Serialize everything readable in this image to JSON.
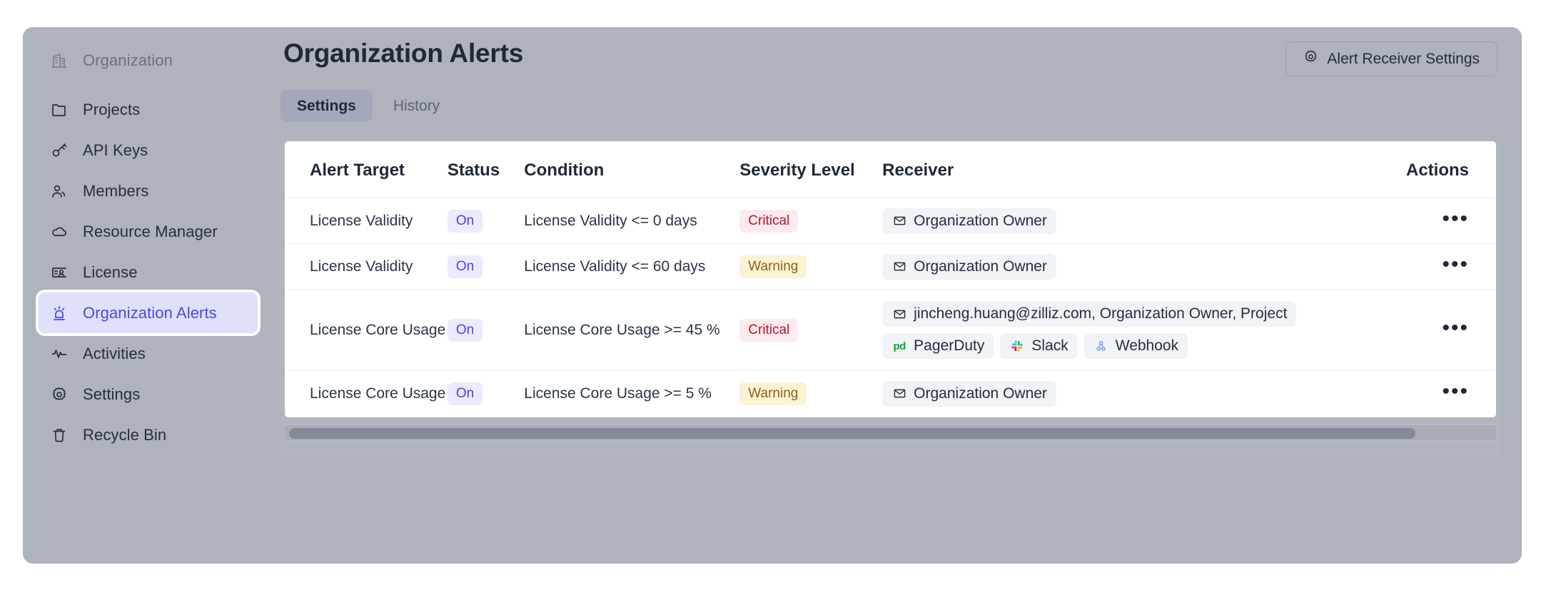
{
  "sidebar": {
    "items": [
      {
        "label": "Organization",
        "icon": "building-icon",
        "state": "muted"
      },
      {
        "label": "Projects",
        "icon": "folder-icon",
        "state": "normal"
      },
      {
        "label": "API Keys",
        "icon": "key-icon",
        "state": "normal"
      },
      {
        "label": "Members",
        "icon": "users-icon",
        "state": "normal"
      },
      {
        "label": "Resource Manager",
        "icon": "cloud-icon",
        "state": "normal"
      },
      {
        "label": "License",
        "icon": "id-card-icon",
        "state": "normal"
      },
      {
        "label": "Organization Alerts",
        "icon": "alert-siren-icon",
        "state": "active"
      },
      {
        "label": "Activities",
        "icon": "pulse-icon",
        "state": "normal"
      },
      {
        "label": "Settings",
        "icon": "gear-icon",
        "state": "normal"
      },
      {
        "label": "Recycle Bin",
        "icon": "trash-icon",
        "state": "normal"
      }
    ]
  },
  "header": {
    "title": "Organization Alerts",
    "alert_receiver_settings_label": "Alert Receiver Settings",
    "alert_receiver_settings_icon": "gear-icon"
  },
  "tabs": [
    {
      "label": "Settings",
      "active": true
    },
    {
      "label": "History",
      "active": false
    }
  ],
  "table": {
    "columns": [
      "Alert Target",
      "Status",
      "Condition",
      "Severity Level",
      "Receiver",
      "Actions"
    ],
    "rows": [
      {
        "alert_target": "License Validity",
        "status": "On",
        "condition": "License Validity <= 0 days",
        "severity": "Critical",
        "receivers": [
          {
            "label": "Organization Owner",
            "icon": "mail-icon"
          }
        ],
        "actions_icon": "more-horizontal-icon"
      },
      {
        "alert_target": "License Validity",
        "status": "On",
        "condition": "License Validity <= 60 days",
        "severity": "Warning",
        "receivers": [
          {
            "label": "Organization Owner",
            "icon": "mail-icon"
          }
        ],
        "actions_icon": "more-horizontal-icon"
      },
      {
        "alert_target": "License Core Usage",
        "status": "On",
        "condition": "License Core Usage >= 45 %",
        "severity": "Critical",
        "receivers": [
          {
            "label": "jincheng.huang@zilliz.com, Organization Owner, Project",
            "icon": "mail-icon"
          },
          {
            "label": "PagerDuty",
            "icon": "pagerduty-icon"
          },
          {
            "label": "Slack",
            "icon": "slack-icon"
          },
          {
            "label": "Webhook",
            "icon": "webhook-icon"
          }
        ],
        "actions_icon": "more-horizontal-icon"
      },
      {
        "alert_target": "License Core Usage",
        "status": "On",
        "condition": "License Core Usage >= 5 %",
        "severity": "Warning",
        "receivers": [
          {
            "label": "Organization Owner",
            "icon": "mail-icon"
          }
        ],
        "actions_icon": "more-horizontal-icon"
      }
    ]
  },
  "colors": {
    "accent": "#4f46e5",
    "critical": "#b4172d",
    "warning": "#8a6313",
    "status_on": "#4b40f2",
    "app_background": "#aeb3bd"
  }
}
